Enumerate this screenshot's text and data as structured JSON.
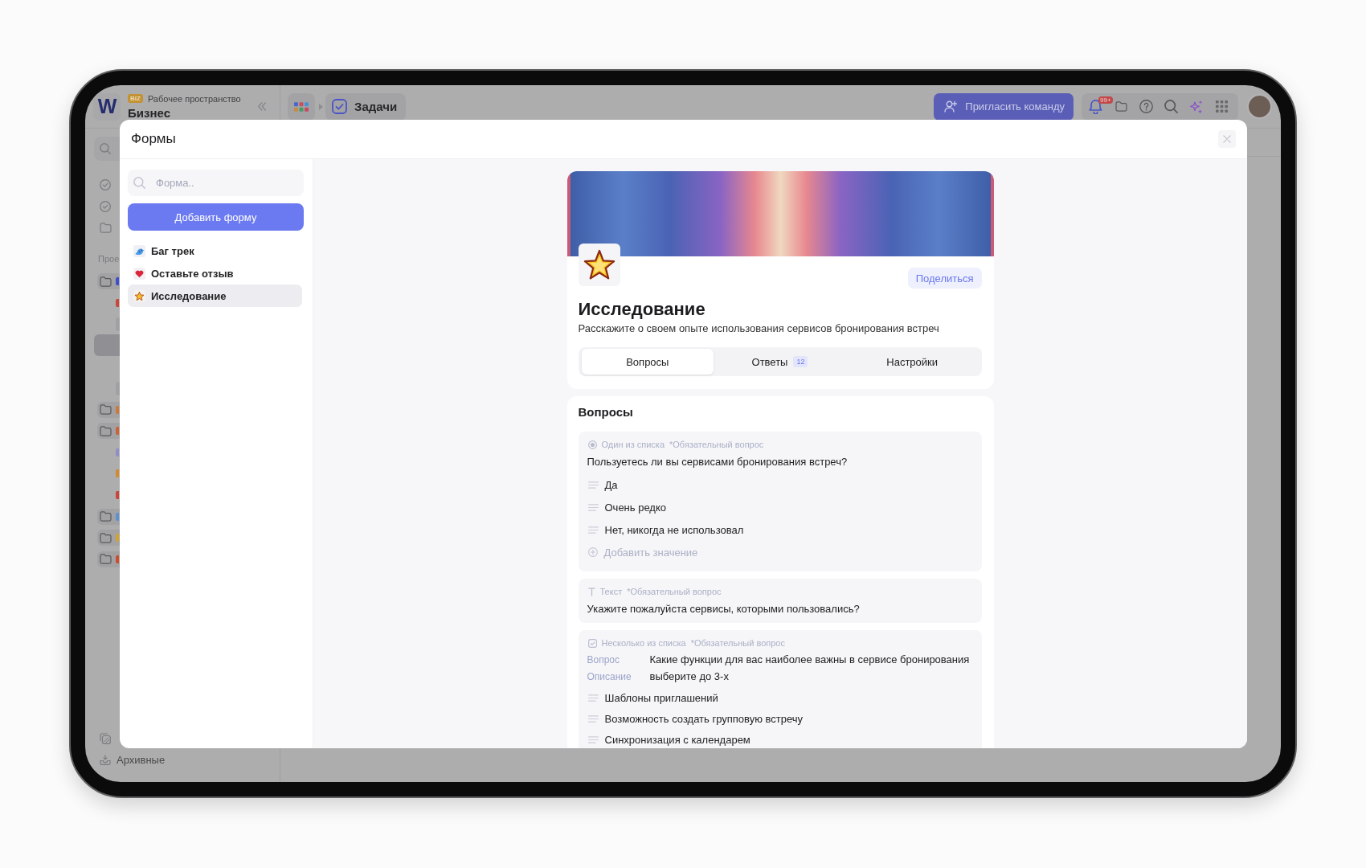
{
  "app": {
    "logo": "W",
    "workspace": {
      "badge": "BIZ",
      "label": "Рабочее пространство",
      "name": "Бизнес"
    },
    "breadcrumb": {
      "label": "Задачи"
    },
    "invite_button": "Пригласить команду",
    "notifications_count": "99+"
  },
  "sidebar": {
    "section_label": "Прое",
    "rows": [
      {
        "kind": "folder",
        "selected": false,
        "color": "#4050c6"
      },
      {
        "kind": "item",
        "selected": false,
        "color": "#c8463a"
      },
      {
        "kind": "group",
        "selected": false
      },
      {
        "kind": "item",
        "selected": true
      },
      {
        "kind": "item",
        "selected": false
      },
      {
        "kind": "group",
        "selected": false
      },
      {
        "kind": "folder",
        "selected": false,
        "color": "#c97a3c"
      },
      {
        "kind": "folder",
        "selected": false,
        "color": "#c8643a"
      },
      {
        "kind": "item",
        "selected": false,
        "color": "#8f8fc4"
      },
      {
        "kind": "item",
        "selected": false,
        "color": "#d08a32"
      },
      {
        "kind": "item",
        "selected": false,
        "color": "#c8463a"
      },
      {
        "kind": "folder",
        "selected": false,
        "color": "#5e92cf"
      },
      {
        "kind": "folder",
        "selected": false,
        "color": "#d2a232"
      },
      {
        "kind": "folder",
        "selected": false,
        "color": "#c8502e"
      }
    ],
    "archived": "Архивные"
  },
  "modal": {
    "title": "Формы",
    "search": {
      "placeholder": "Форма.."
    },
    "add_button": "Добавить форму",
    "forms": [
      {
        "name": "Баг трек",
        "kind": "bird",
        "selected": false
      },
      {
        "name": "Оставьте отзыв",
        "kind": "heart",
        "selected": false
      },
      {
        "name": "Исследование",
        "kind": "star",
        "selected": true
      }
    ],
    "form": {
      "title": "Исследование",
      "description": "Расскажите о своем опыте использования сервисов бронирования встреч",
      "share_button": "Поделиться",
      "tabs": [
        {
          "label": "Вопросы",
          "selected": true
        },
        {
          "label": "Ответы",
          "count": "12",
          "selected": false
        },
        {
          "label": "Настройки",
          "selected": false
        }
      ]
    },
    "questions": {
      "heading": "Вопросы",
      "items": [
        {
          "kind": "single",
          "type_label": "Один из списка",
          "required": "*Обязательный вопрос",
          "text": "Пользуетесь ли вы сервисами бронирования встреч?",
          "options": [
            "Да",
            "Очень редко",
            "Нет, никогда не использовал"
          ],
          "add_option": "Добавить значение"
        },
        {
          "kind": "text",
          "type_label": "Текст",
          "required": "*Обязательный вопрос",
          "text": "Укажите пожалуйста сервисы, которыми пользовались?"
        },
        {
          "kind": "multiple",
          "type_label": "Несколько из списка",
          "required": "*Обязательный вопрос",
          "fields": [
            {
              "label": "Вопрос",
              "value": "Какие функции для вас наиболее важны в сервисе бронирования"
            },
            {
              "label": "Описание",
              "value": "выберите до 3-х"
            }
          ],
          "options": [
            "Шаблоны приглашений",
            "Возможность создать групповую встречу",
            "Синхронизация с календарем"
          ]
        }
      ]
    }
  }
}
